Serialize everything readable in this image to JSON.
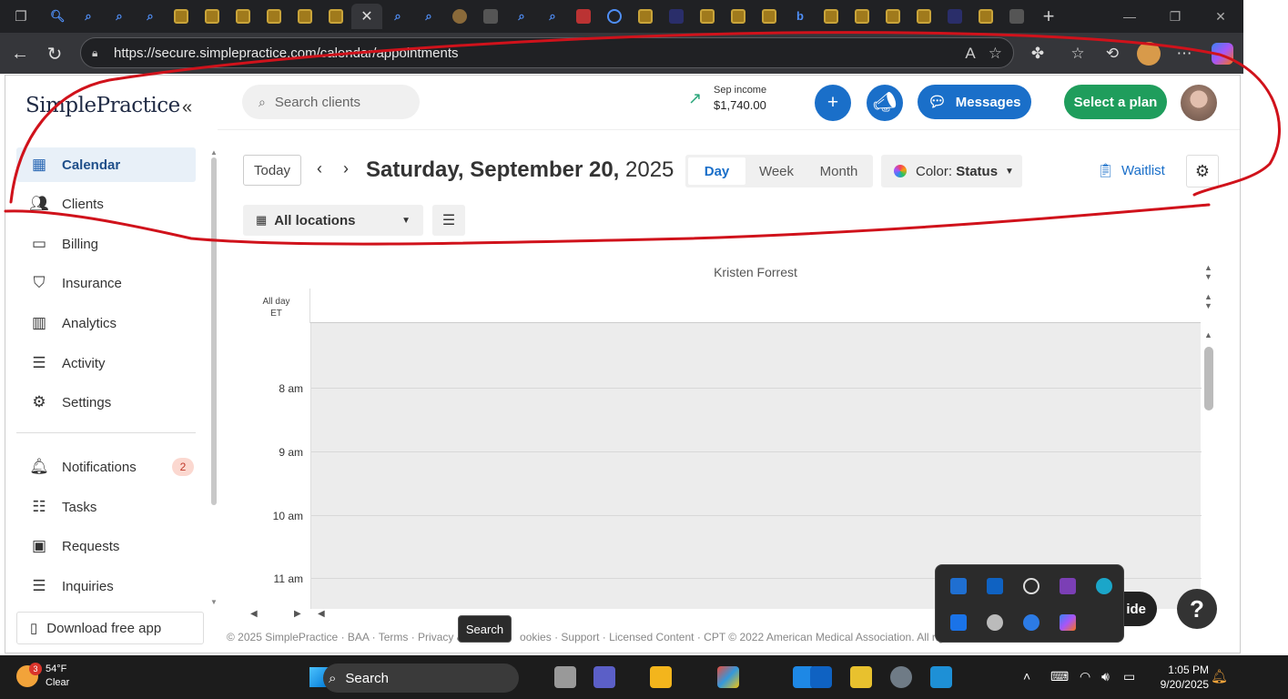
{
  "browser": {
    "url": "https://secure.simplepractice.com/calendar/appointments"
  },
  "sidebar": {
    "logo": "SimplePractice",
    "items": [
      {
        "label": "Calendar"
      },
      {
        "label": "Clients"
      },
      {
        "label": "Billing"
      },
      {
        "label": "Insurance"
      },
      {
        "label": "Analytics"
      },
      {
        "label": "Activity"
      },
      {
        "label": "Settings"
      },
      {
        "label": "Notifications",
        "badge": "2"
      },
      {
        "label": "Tasks"
      },
      {
        "label": "Requests"
      },
      {
        "label": "Inquiries"
      }
    ],
    "download_label": "Download free app"
  },
  "topbar": {
    "search_placeholder": "Search clients",
    "income_label": "Sep income",
    "income_value": "$1,740.00",
    "messages_label": "Messages",
    "plan_label": "Select a plan"
  },
  "toolbar": {
    "today_label": "Today",
    "date_main": "Saturday, September 20,",
    "date_year": "2025",
    "views": [
      "Day",
      "Week",
      "Month"
    ],
    "active_view": "Day",
    "color_prefix": "Color:",
    "color_value": "Status",
    "waitlist_label": "Waitlist",
    "locations_label": "All locations"
  },
  "calendar": {
    "clinician": "Kristen Forrest",
    "allday_label": "All day",
    "timezone": "ET",
    "hours": [
      "8 am",
      "9 am",
      "10 am",
      "11 am"
    ]
  },
  "footer": {
    "text": "© 2025 SimplePractice · BAA · Terms · Privacy & ",
    "text2": "ookies · Support · Licensed Content · CPT © 2022 American Medical Association. All righ"
  },
  "help": {
    "label": "?",
    "guide_label": "ide"
  },
  "tooltip": "Search",
  "taskbar": {
    "weather_badge": "3",
    "temp": "54°F",
    "condition": "Clear",
    "search_label": "Search",
    "time": "1:05 PM",
    "date": "9/20/2025"
  },
  "colors": {
    "primary": "#1a6fc9",
    "success": "#1f9d5c",
    "annotation": "#d0121b"
  }
}
